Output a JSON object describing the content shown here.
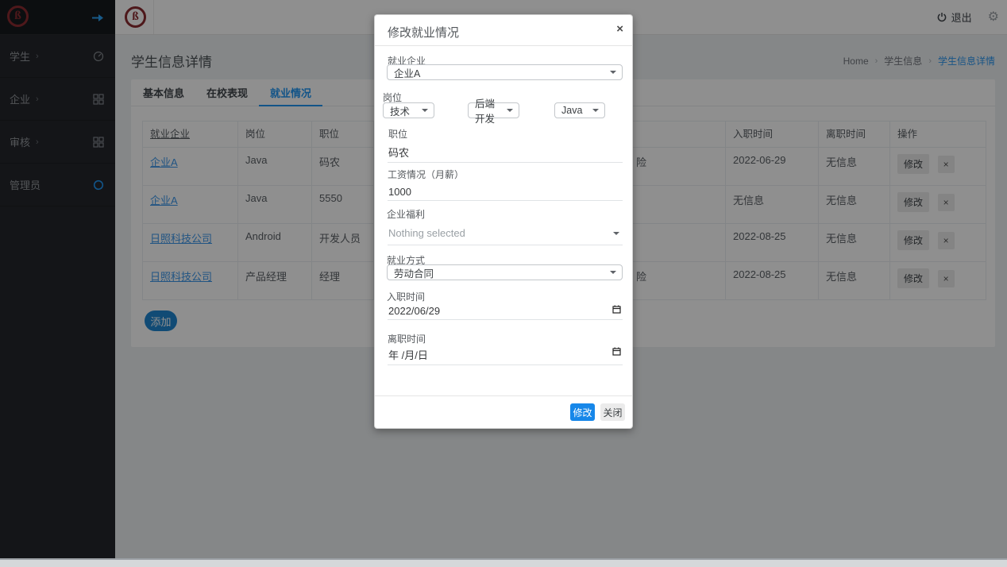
{
  "colors": {
    "accent": "#2196f3",
    "primary_button": "#1787e9",
    "logo": "#8c2b30",
    "add_button": "#1f86d0"
  },
  "sidebar": {
    "logo_glyph": "ß",
    "items": [
      {
        "label": "学生",
        "chevron": "›"
      },
      {
        "label": "企业",
        "chevron": "›"
      },
      {
        "label": "审核",
        "chevron": "›"
      },
      {
        "label": "管理员",
        "chevron": ""
      }
    ]
  },
  "header": {
    "logo_glyph": "ß",
    "logout": "退出"
  },
  "breadcrumb": {
    "home": "Home",
    "sep": "›",
    "parent": "学生信息",
    "current": "学生信息详情"
  },
  "page": {
    "title": "学生信息详情",
    "tabs": [
      {
        "label": "基本信息"
      },
      {
        "label": "在校表现"
      },
      {
        "label": "就业情况"
      }
    ],
    "add_button": "添加"
  },
  "table": {
    "columns": [
      "就业企业",
      "岗位",
      "职位",
      "",
      "",
      "",
      "入职时间",
      "离职时间",
      "操作"
    ],
    "edit_label": "修改",
    "delete_label": "×",
    "rows": [
      {
        "company": "企业A",
        "post": "Java",
        "position": "码农",
        "peek": "险",
        "entry": "2022-06-29",
        "leave": "无信息"
      },
      {
        "company": "企业A",
        "post": "Java",
        "position": "5550",
        "peek": "",
        "entry": "无信息",
        "leave": "无信息"
      },
      {
        "company": "日照科技公司",
        "post": "Android",
        "position": "开发人员",
        "peek": "",
        "entry": "2022-08-25",
        "leave": "无信息"
      },
      {
        "company": "日照科技公司",
        "post": "产品经理",
        "position": "经理",
        "peek": "险",
        "entry": "2022-08-25",
        "leave": "无信息"
      }
    ]
  },
  "modal": {
    "title": "修改就业情况",
    "close": "×",
    "company": {
      "label": "就业企业",
      "value": "企业A"
    },
    "post": {
      "label": "岗位",
      "level1": "技术",
      "level2": "后端开发",
      "level3": "Java"
    },
    "position": {
      "label": "职位",
      "value": "码农"
    },
    "salary": {
      "label": "工资情况（月薪）",
      "value": "1000"
    },
    "benefits": {
      "label": "企业福利",
      "value": "Nothing selected"
    },
    "method": {
      "label": "就业方式",
      "value": "劳动合同"
    },
    "entry": {
      "label": "入职时间",
      "value": "2022/06/29"
    },
    "leave": {
      "label": "离职时间",
      "value": "年 /月/日"
    },
    "submit": "修改",
    "cancel": "关闭"
  }
}
